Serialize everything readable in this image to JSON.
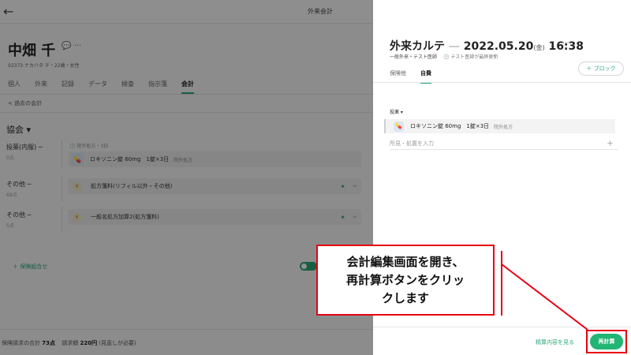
{
  "left": {
    "topbar_title": "外来会計",
    "patient": {
      "name": "中畑 千",
      "icons": "💬 ···",
      "sub": "02373 ナカハタ チ・22歳・女性"
    },
    "tabs": [
      "個人",
      "外来",
      "記録",
      "データ",
      "検査",
      "指示箋",
      "会計"
    ],
    "past_link": "< 過去の会計",
    "section_title": "協会 ▾",
    "rows": [
      {
        "label": "投薬(内服) ─",
        "sub": "0点",
        "note": "🕒 院外処方・3日",
        "item": "ロキソニン錠 60mg　1錠×3日",
        "tag": "院外処方"
      },
      {
        "label": "その他 ─",
        "sub": "68点",
        "item": "処方箋料(リフィル以外・その他)"
      },
      {
        "label": "その他 ─",
        "sub": "5点",
        "item": "一般名処方加算2(処方箋料)"
      }
    ],
    "add_insurance": "＋ 保険組合せ",
    "footer": {
      "label_total": "保険請求の合計",
      "total": "73点",
      "label_bill": "請求額",
      "bill": "220円",
      "bill_note": "(見直しが必要)"
    }
  },
  "right": {
    "title": "外来カルテ",
    "dash": "—",
    "date": "2022.05.20",
    "dow": "(金)",
    "time": "16:38",
    "more": "···",
    "sub_type": "一般外来・テスト医師",
    "sub_updated": "🕒 テスト医師が最終更新",
    "tabs": [
      "保険他",
      "自費"
    ],
    "block_button": "＋ ブロック",
    "rx_label": "投薬 ▾",
    "rx_item": "ロキソニン錠 60mg　1錠×3日",
    "rx_tag": "院外処方",
    "input_placeholder": "所見・処置を入力",
    "plus": "＋",
    "view_link": "精算内容を見る",
    "recalc_button": "再計算"
  },
  "annotation": {
    "lines": [
      "会計編集画面を開き、",
      "再計算ボタンをクリッ",
      "クします"
    ],
    "color": "#e60012"
  },
  "colors": {
    "accent": "#22b573",
    "highlight": "#e60012"
  }
}
